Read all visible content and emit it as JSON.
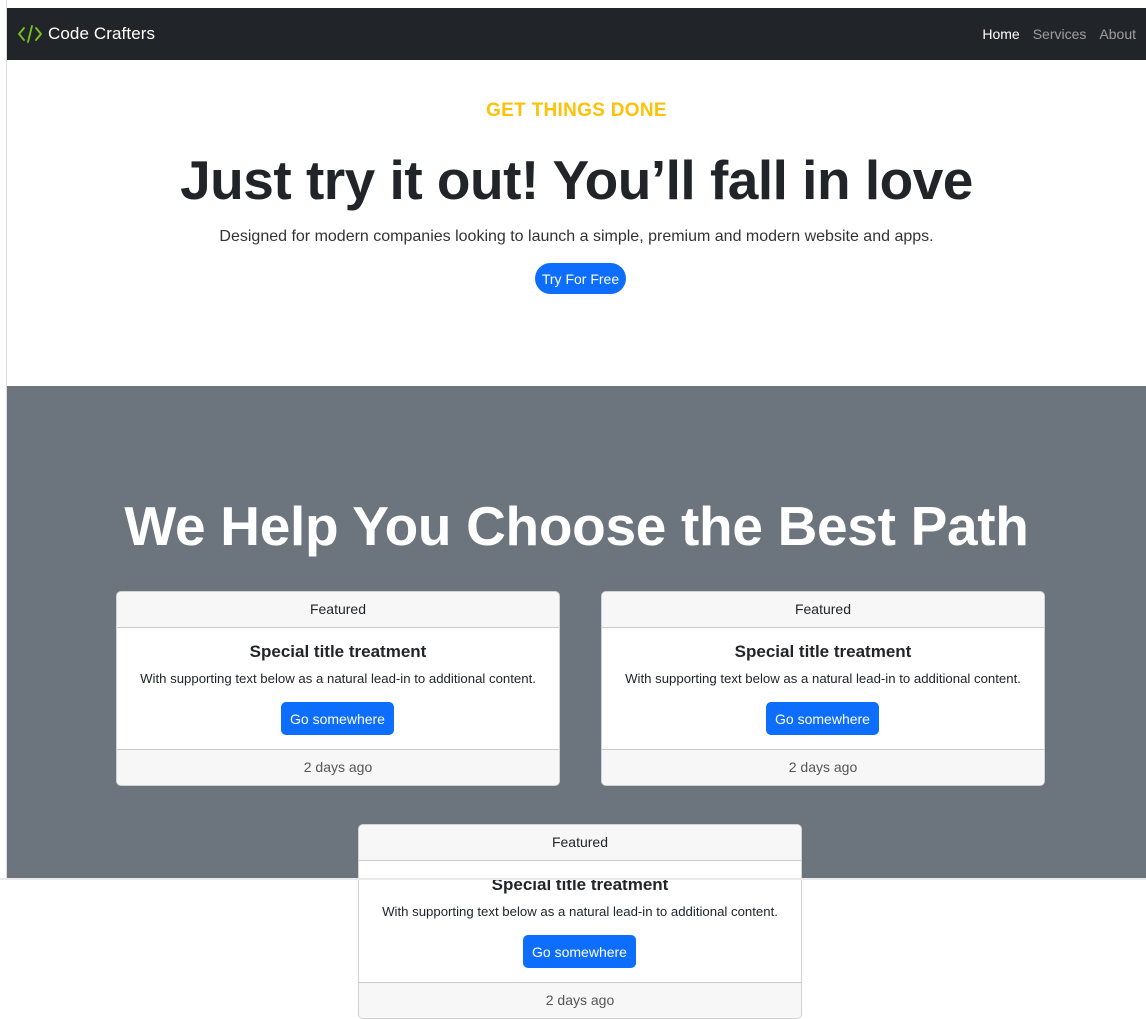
{
  "navbar": {
    "brand": "Code Crafters",
    "brand_icon": "code-icon",
    "links": [
      {
        "label": "Home",
        "active": true
      },
      {
        "label": "Services",
        "active": false
      },
      {
        "label": "About",
        "active": false
      }
    ]
  },
  "hero": {
    "eyebrow": "GET THINGS DONE",
    "title": "Just try it out! You’ll fall in love",
    "subtitle": "Designed for modern companies looking to launch a simple, premium and modern website and apps.",
    "cta": "Try For Free"
  },
  "section": {
    "title": "We Help You Choose the Best Path"
  },
  "cards": [
    {
      "header": "Featured",
      "title": "Special title treatment",
      "text": "With supporting text below as a natural lead-in to additional content.",
      "button": "Go somewhere",
      "footer": "2 days ago"
    },
    {
      "header": "Featured",
      "title": "Special title treatment",
      "text": "With supporting text below as a natural lead-in to additional content.",
      "button": "Go somewhere",
      "footer": "2 days ago"
    },
    {
      "header": "Featured",
      "title": "Special title treatment",
      "text": "With supporting text below as a natural lead-in to additional content.",
      "button": "Go somewhere",
      "footer": "2 days ago"
    }
  ],
  "colors": {
    "navbar_bg": "#212529",
    "brand_icon": "#7cc31f",
    "accent_yellow": "#ffc107",
    "primary_blue": "#0d6efd",
    "section_gray": "#6c757d"
  }
}
